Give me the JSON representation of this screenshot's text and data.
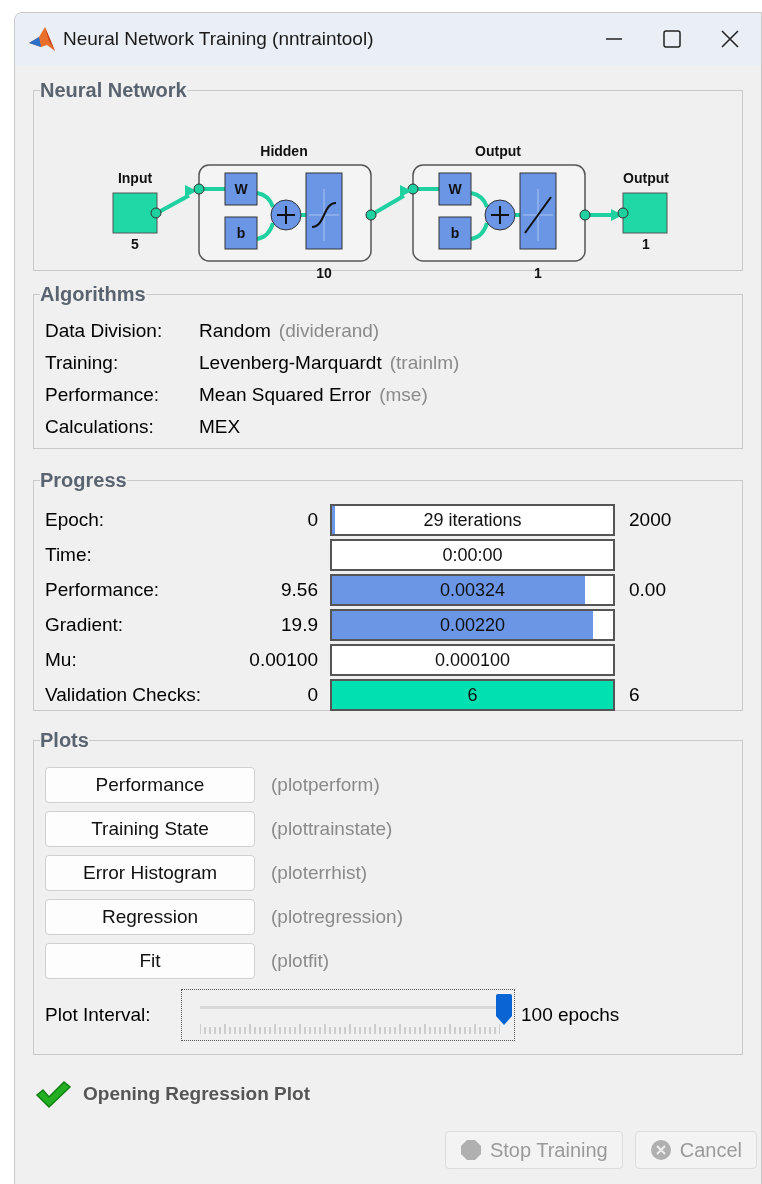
{
  "window": {
    "title": "Neural Network Training (nntraintool)"
  },
  "network": {
    "title": "Neural Network",
    "input": {
      "label": "Input",
      "size": "5"
    },
    "layers": [
      {
        "title": "Hidden",
        "weight": "W",
        "bias": "b",
        "size": "10",
        "kind": "sigmoid"
      },
      {
        "title": "Output",
        "weight": "W",
        "bias": "b",
        "size": "1",
        "kind": "linear"
      }
    ],
    "output": {
      "label": "Output",
      "size": "1"
    }
  },
  "algorithms": {
    "title": "Algorithms",
    "rows": [
      {
        "label": "Data Division:",
        "value": "Random",
        "function": "(dividerand)"
      },
      {
        "label": "Training:",
        "value": "Levenberg-Marquardt",
        "function": "(trainlm)"
      },
      {
        "label": "Performance:",
        "value": "Mean Squared Error",
        "function": "(mse)"
      },
      {
        "label": "Calculations:",
        "value": "MEX"
      }
    ]
  },
  "progress": {
    "title": "Progress",
    "rows": [
      {
        "label": "Epoch:",
        "start": "0",
        "reading": "29 iterations",
        "end": "2000",
        "level": 0.01,
        "color": "#6b96e6"
      },
      {
        "label": "Time:",
        "reading": "0:00:00",
        "level": 0
      },
      {
        "label": "Performance:",
        "start": "9.56",
        "reading": "0.00324",
        "end": "0.00",
        "level": 0.9,
        "color": "#6b96e6"
      },
      {
        "label": "Gradient:",
        "start": "19.9",
        "reading": "0.00220",
        "level": 0.93,
        "color": "#6b96e6"
      },
      {
        "label": "Mu:",
        "start": "0.00100",
        "reading": "0.000100",
        "level": 0
      },
      {
        "label": "Validation Checks:",
        "start": "0",
        "reading": "6",
        "end": "6",
        "level": 1,
        "color": "#00e0b0"
      }
    ]
  },
  "plots": {
    "title": "Plots",
    "buttons": [
      {
        "label": "Performance",
        "function": "(plotperform)"
      },
      {
        "label": "Training State",
        "function": "(plottrainstate)"
      },
      {
        "label": "Error Histogram",
        "function": "(ploterrhist)"
      },
      {
        "label": "Regression",
        "function": "(plotregression)"
      },
      {
        "label": "Fit",
        "function": "(plotfit)"
      }
    ],
    "interval": {
      "label": "Plot Interval:",
      "level": 1,
      "reading": "100 epochs"
    }
  },
  "status": {
    "text": "Opening Regression Plot"
  },
  "buttons": [
    {
      "label": "Stop Training",
      "kind": "stop",
      "disabled": true
    },
    {
      "label": "Cancel",
      "kind": "cancel",
      "disabled": true
    }
  ]
}
